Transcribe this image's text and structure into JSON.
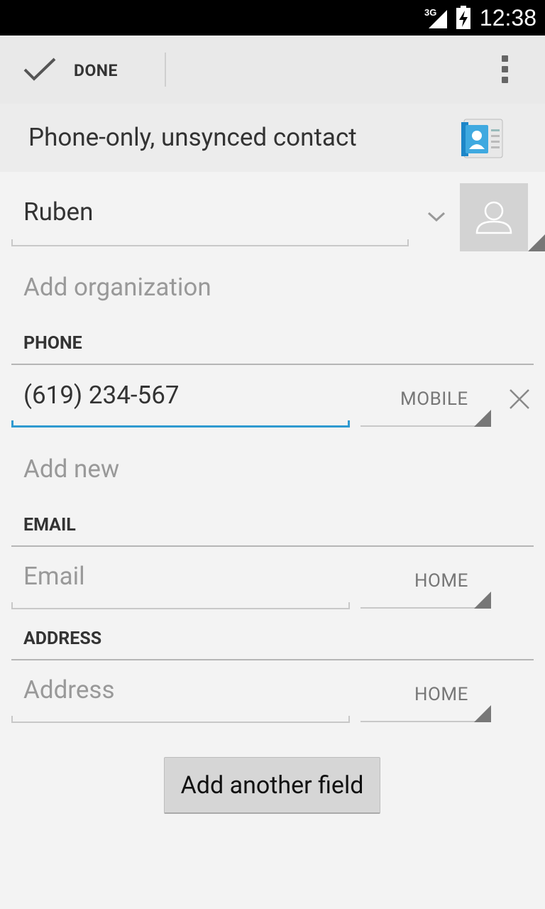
{
  "status_bar": {
    "network": "3G",
    "time": "12:38"
  },
  "action_bar": {
    "done_label": "DONE"
  },
  "account_header": {
    "title": "Phone-only, unsynced contact",
    "icon": "contacts-app-icon"
  },
  "name_field": {
    "value": "Ruben"
  },
  "organization": {
    "label": "Add organization"
  },
  "phone_section": {
    "header": "PHONE",
    "value": "(619) 234-567",
    "type": "MOBILE",
    "add_new": "Add new"
  },
  "email_section": {
    "header": "EMAIL",
    "placeholder": "Email",
    "type": "HOME"
  },
  "address_section": {
    "header": "ADDRESS",
    "placeholder": "Address",
    "type": "HOME"
  },
  "add_field_button": "Add another field",
  "colors": {
    "accent": "#2f9ad0",
    "background": "#f3f3f3",
    "action_bar": "#e9e9e9"
  }
}
